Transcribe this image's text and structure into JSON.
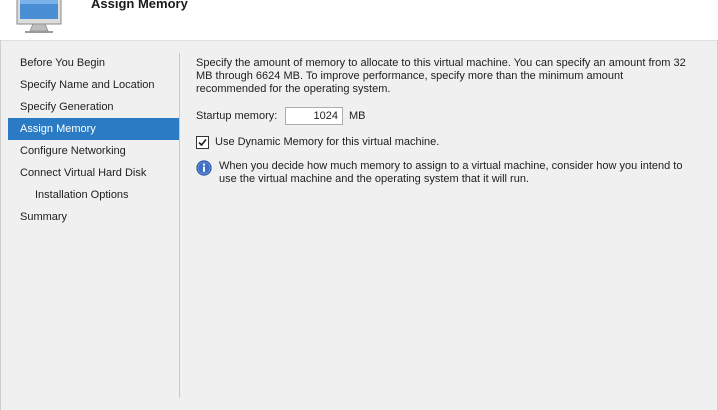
{
  "header": {
    "title": "Assign Memory",
    "icon": "virtual-machine-monitor-icon"
  },
  "nav": {
    "items": [
      {
        "label": "Before You Begin",
        "active": false
      },
      {
        "label": "Specify Name and Location",
        "active": false
      },
      {
        "label": "Specify Generation",
        "active": false
      },
      {
        "label": "Assign Memory",
        "active": true
      },
      {
        "label": "Configure Networking",
        "active": false
      },
      {
        "label": "Connect Virtual Hard Disk",
        "active": false
      },
      {
        "label": "Installation Options",
        "active": false
      },
      {
        "label": "Summary",
        "active": false
      }
    ]
  },
  "main": {
    "description": "Specify the amount of memory to allocate to this virtual machine. You can specify an amount from 32 MB through 6624 MB. To improve performance, specify more than the minimum amount recommended for the operating system.",
    "startup_memory_label": "Startup memory:",
    "startup_memory_value": "1024",
    "startup_memory_unit": "MB",
    "dynamic_memory_label": "Use Dynamic Memory for this virtual machine.",
    "dynamic_memory_checked": true,
    "info_text": "When you decide how much memory to assign to a virtual machine, consider how you intend to use the virtual machine and the operating system that it will run.",
    "info_icon": "info-icon"
  },
  "colors": {
    "accent": "#2b7bc4",
    "background": "#f0f0f0",
    "header_bg": "#ffffff"
  }
}
